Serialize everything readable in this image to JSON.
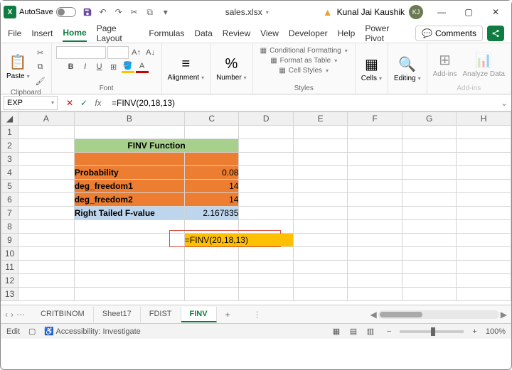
{
  "title": {
    "autosave_label": "AutoSave",
    "filename": "sales.xlsx",
    "username": "Kunal Jai Kaushik",
    "avatar_initials": "KJ"
  },
  "menu": {
    "items": [
      "File",
      "Insert",
      "Home",
      "Page Layout",
      "Formulas",
      "Data",
      "Review",
      "View",
      "Developer",
      "Help",
      "Power Pivot"
    ],
    "active_index": 2,
    "comments_label": "Comments"
  },
  "ribbon": {
    "clipboard": {
      "label": "Clipboard",
      "paste": "Paste"
    },
    "font": {
      "label": "Font"
    },
    "alignment": {
      "label": "Alignment",
      "btn": "Alignment"
    },
    "number": {
      "label": "Number",
      "btn": "Number"
    },
    "styles": {
      "label": "Styles",
      "cond_fmt": "Conditional Formatting",
      "as_table": "Format as Table",
      "cell_styles": "Cell Styles"
    },
    "cells": {
      "label": "Cells",
      "btn": "Cells"
    },
    "editing": {
      "label": "Editing",
      "btn": "Editing"
    },
    "addins": {
      "label": "Add-ins",
      "addins_btn": "Add-ins",
      "analyze_btn": "Analyze Data"
    }
  },
  "formula_bar": {
    "name_box": "EXP",
    "formula": "=FINV(20,18,13)"
  },
  "grid": {
    "columns": [
      "A",
      "B",
      "C",
      "D",
      "E",
      "F",
      "G",
      "H"
    ],
    "rows": [
      1,
      2,
      3,
      4,
      5,
      6,
      7,
      8,
      9,
      10,
      11,
      12,
      13
    ],
    "title_merged": "FINV Function",
    "r4": {
      "b": "Probability",
      "c": "0.08"
    },
    "r5": {
      "b": "deg_freedom1",
      "c": "14"
    },
    "r6": {
      "b": "deg_freedom2",
      "c": "14"
    },
    "r7": {
      "b": "Right Tailed F-value",
      "c": "2.167835"
    },
    "r9_edit": "=FINV(20,18,13)"
  },
  "sheets": {
    "tabs": [
      "CRITBINOM",
      "Sheet17",
      "FDIST",
      "FINV"
    ],
    "active_index": 3
  },
  "statusbar": {
    "mode": "Edit",
    "accessibility": "Accessibility: Investigate",
    "zoom": "100%"
  }
}
